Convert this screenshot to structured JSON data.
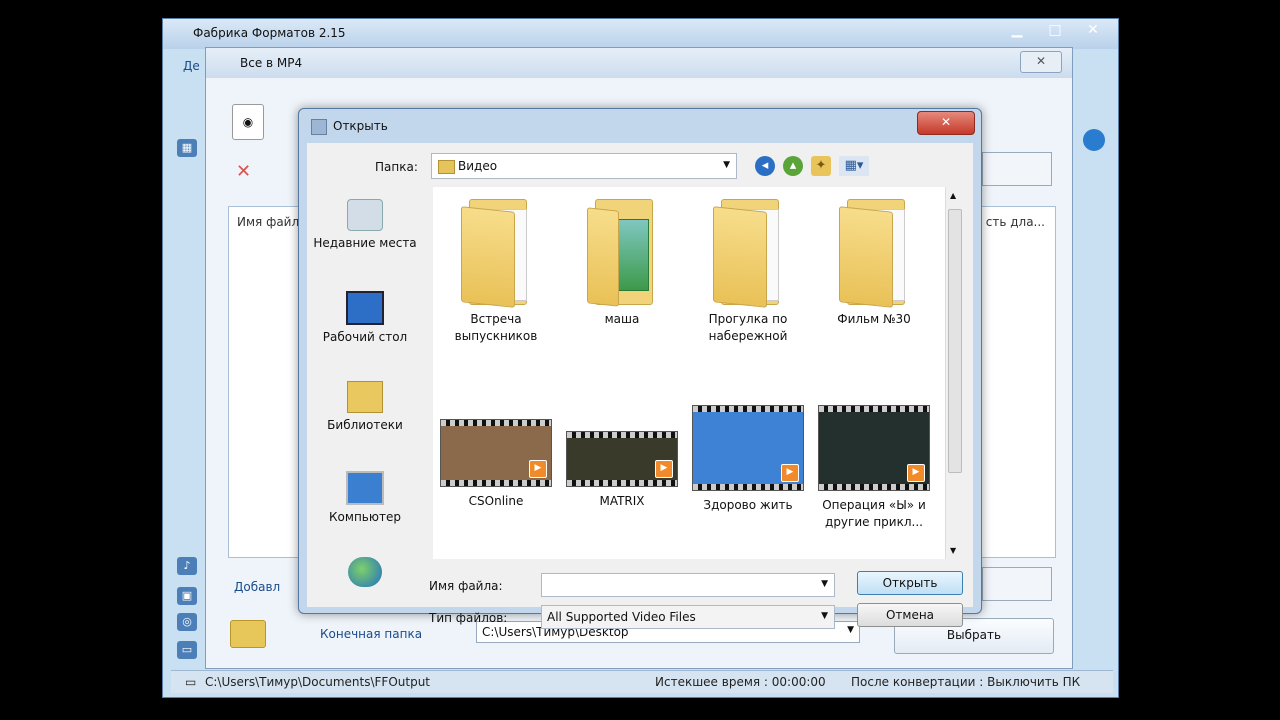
{
  "app": {
    "title": "Фабрика Форматов 2.15",
    "menu_first": "Де",
    "status_path": "C:\\Users\\Тимур\\Documents\\FFOutput",
    "elapsed": "Истекшее время : 00:00:00",
    "after_conv": "После конвертации : Выключить ПК"
  },
  "inner": {
    "title": "Все в MP4",
    "list_header": "Имя файл",
    "list_header_right": "сть дла...",
    "add_label": "Добавл",
    "dest_label": "Конечная папка",
    "dest_path": "C:\\Users\\Тимур\\Desktop",
    "pick_button": "Выбрать"
  },
  "dialog": {
    "title": "Открыть",
    "folder_label": "Папка:",
    "folder_value": "Видео",
    "places": [
      {
        "label": "Недавние места",
        "icon": "recent-places-icon"
      },
      {
        "label": "Рабочий стол",
        "icon": "desktop-icon"
      },
      {
        "label": "Библиотеки",
        "icon": "libraries-icon"
      },
      {
        "label": "Компьютер",
        "icon": "computer-icon"
      },
      {
        "label": "",
        "icon": "network-icon"
      }
    ],
    "folders": [
      {
        "label": "Встреча выпускников",
        "pic": false
      },
      {
        "label": "маша",
        "pic": true
      },
      {
        "label": "Прогулка по набережной",
        "pic": false
      },
      {
        "label": "Фильм №30",
        "pic": false
      }
    ],
    "videos": [
      {
        "label": "CSOnline",
        "color": "#8a6a4a"
      },
      {
        "label": "MATRIX",
        "color": "#3a3a2a"
      },
      {
        "label": "Здорово жить",
        "color": "#3e82d6"
      },
      {
        "label": "Операция «Ы» и другие прикл...",
        "color": "#23302e"
      }
    ],
    "filename_label": "Имя файла:",
    "filename_value": "",
    "filetype_label": "Тип файлов:",
    "filetype_value": "All Supported Video Files",
    "open_button": "Открыть",
    "cancel_button": "Отмена"
  }
}
